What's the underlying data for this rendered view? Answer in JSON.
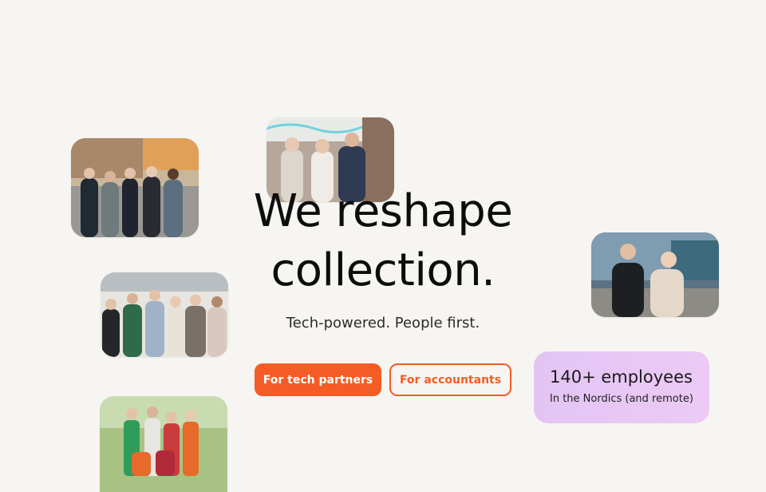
{
  "hero": {
    "title_line1": "We reshape",
    "title_line2": "collection.",
    "tagline": "Tech-powered. People first."
  },
  "buttons": {
    "tech_partners": "For tech partners",
    "accountants": "For accountants"
  },
  "stat_card": {
    "headline": "140+ employees",
    "subline": "In the Nordics (and remote)"
  },
  "colors": {
    "accent": "#f35c25",
    "background": "#f7f5f1",
    "stat_card": "#e3c4f3"
  }
}
